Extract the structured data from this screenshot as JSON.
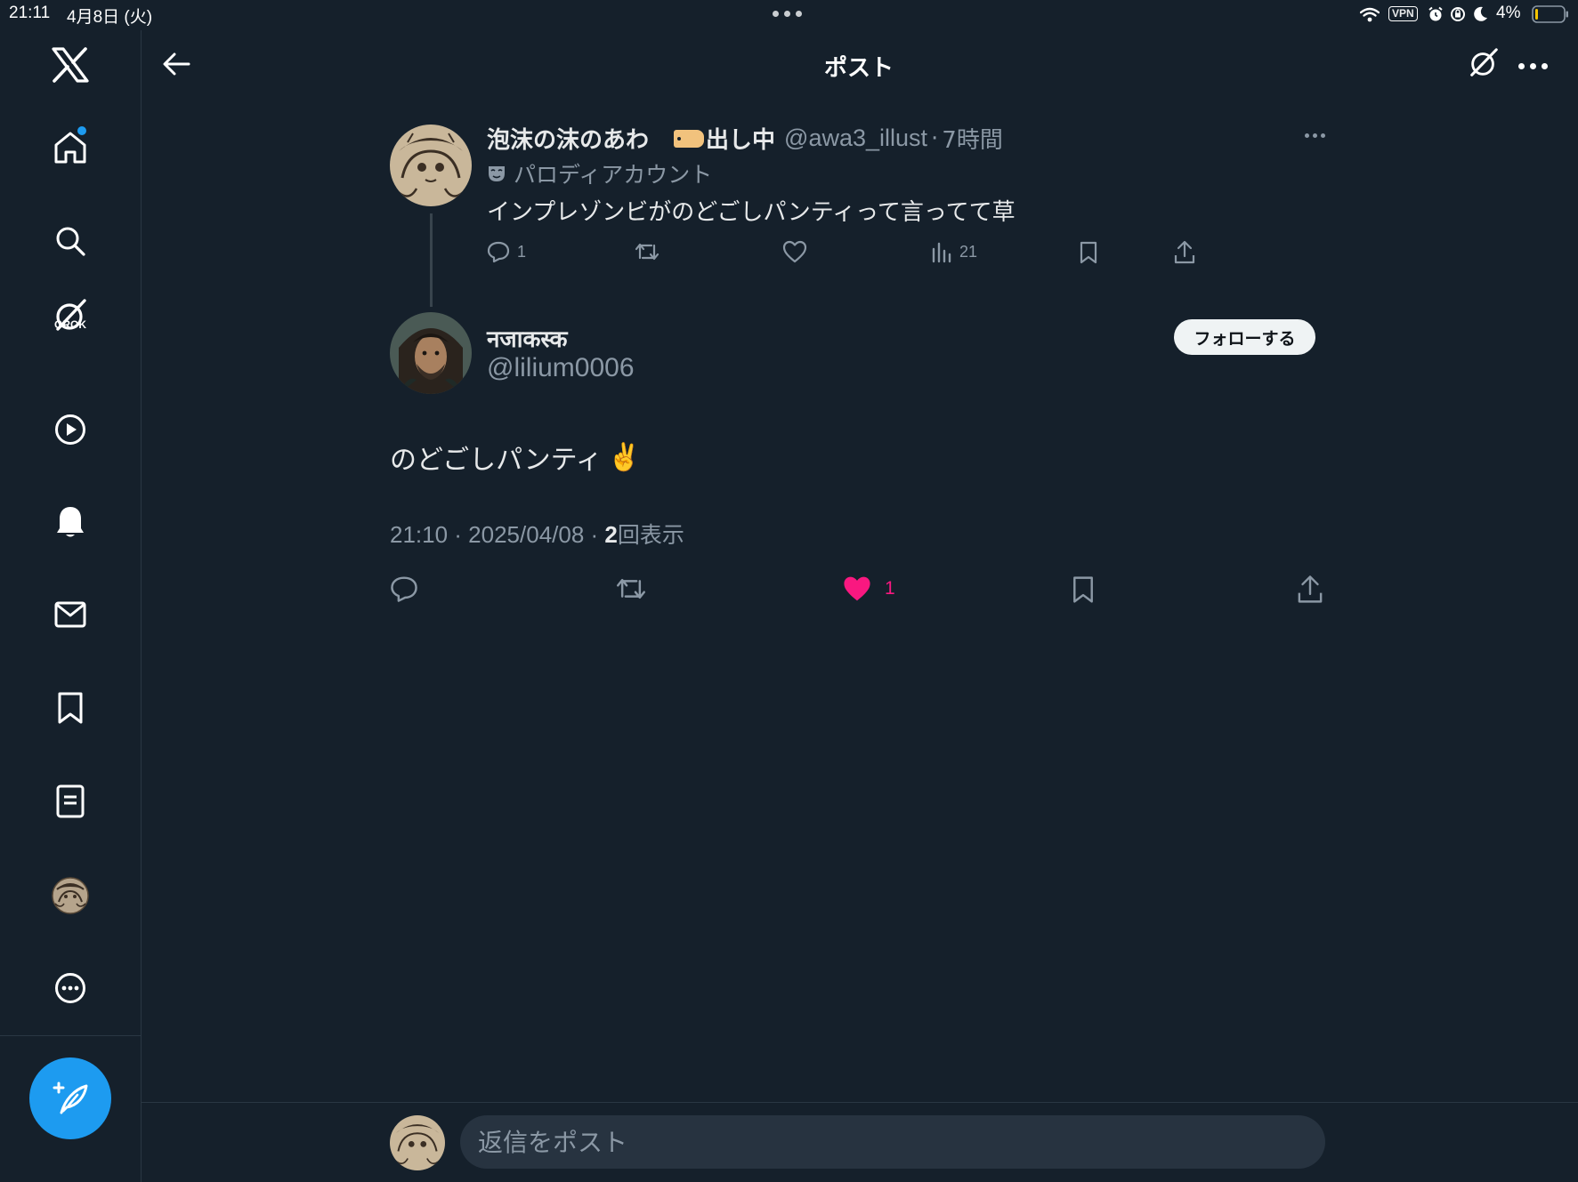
{
  "status_bar": {
    "time": "21:11",
    "date": "4月8日 (火)",
    "vpn": "VPN",
    "battery": "4%"
  },
  "header": {
    "title": "ポスト"
  },
  "parent_post": {
    "display_name": "泡沫の沫のあわ",
    "badge_text": "出し中",
    "handle": "@awa3_illust",
    "separator": "·",
    "time": "7時間",
    "parody_label": "パロディアカウント",
    "text": "インプレゾンビがのどごしパンティって言ってて草",
    "reply_count": "1",
    "view_count": "21"
  },
  "main_post": {
    "display_name": "नजाकस्क",
    "handle": "@lilium0006",
    "follow_label": "フォローする",
    "text": "のどごしパンティ",
    "emoji": "✌️",
    "timestamp": "21:10 · 2025/04/08 · ",
    "view_count": "2",
    "view_suffix": "回表示",
    "like_count": "1"
  },
  "reply_composer": {
    "placeholder": "返信をポスト"
  },
  "sidebar": {
    "grok_label": "GROK"
  },
  "colors": {
    "background": "#15202b",
    "accent": "#1d9bf0",
    "like": "#f91880",
    "muted_text": "#8b98a5"
  }
}
